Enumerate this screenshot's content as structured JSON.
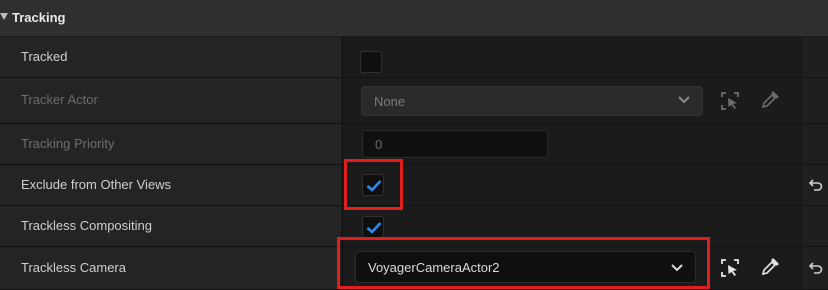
{
  "section": {
    "title": "Tracking"
  },
  "rows": [
    {
      "label": "Tracked"
    },
    {
      "label": "Tracker Actor",
      "value": "None"
    },
    {
      "label": "Tracking Priority",
      "value": "0"
    },
    {
      "label": "Exclude from Other Views",
      "checked": true
    },
    {
      "label": "Trackless Compositing",
      "checked": true
    },
    {
      "label": "Trackless Camera",
      "value": "VoyagerCameraActor2"
    }
  ],
  "colors": {
    "highlight": "#e01e1e",
    "check": "#2d8cf0",
    "checked_bg": "#1565c0"
  }
}
